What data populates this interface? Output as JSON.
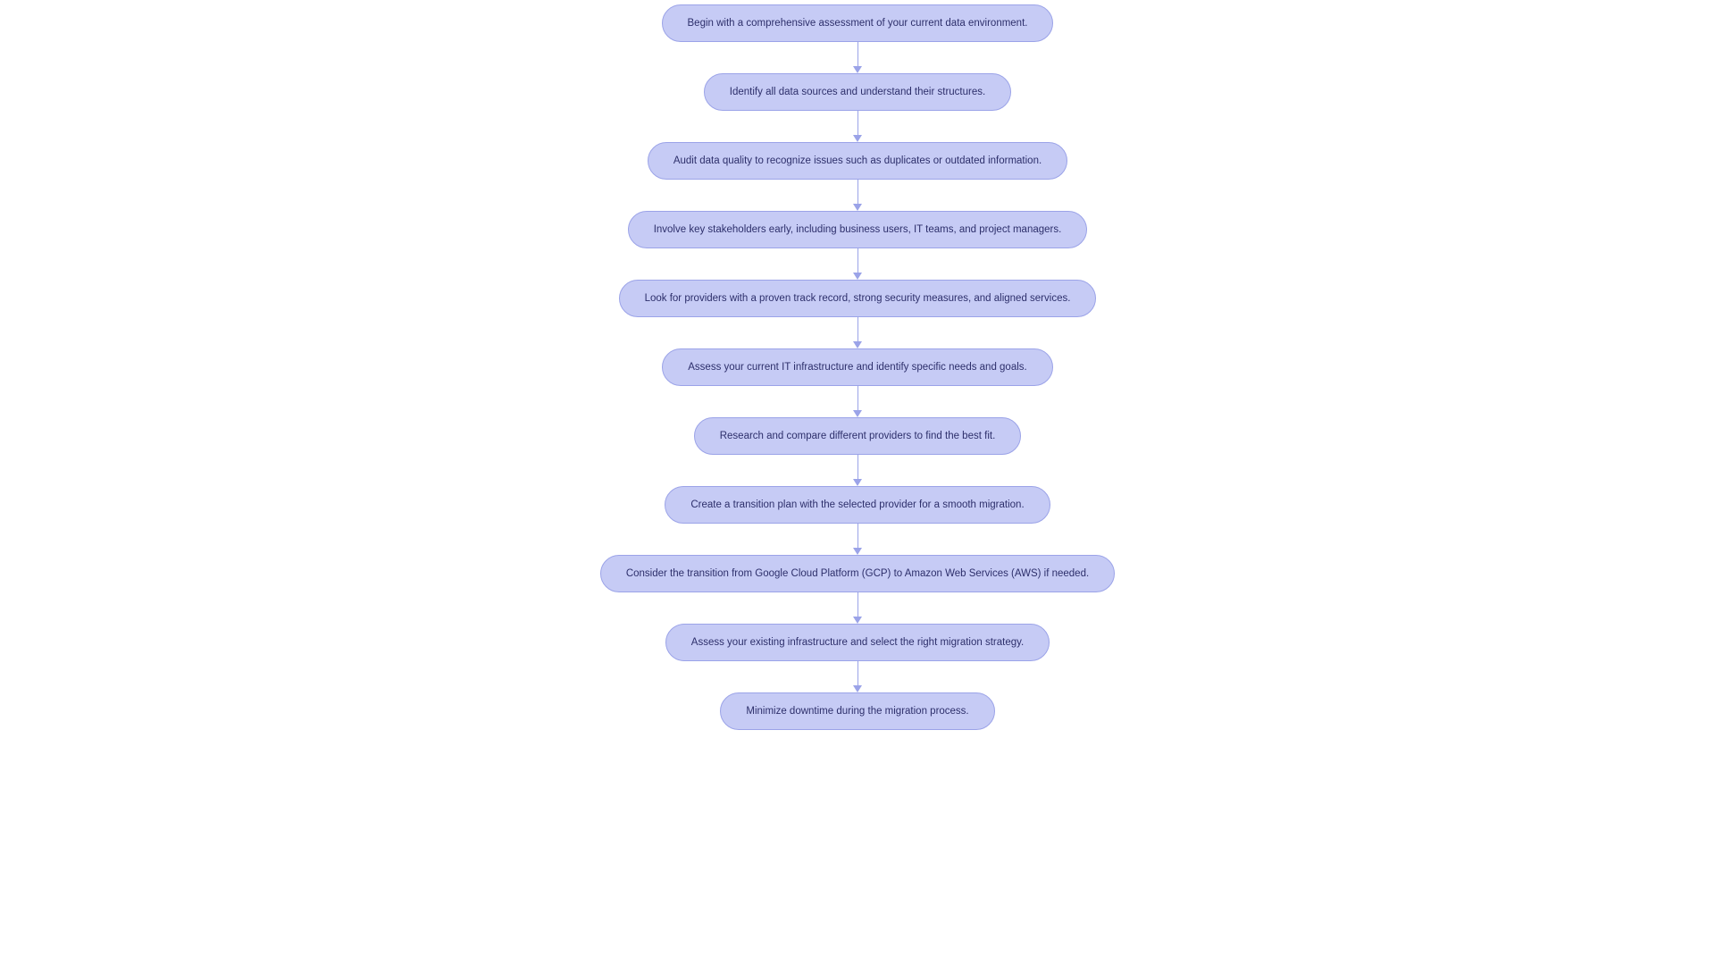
{
  "flowchart": {
    "nodes": [
      {
        "text": "Begin with a comprehensive assessment of your current data environment."
      },
      {
        "text": "Identify all data sources and understand their structures."
      },
      {
        "text": "Audit data quality to recognize issues such as duplicates or outdated information."
      },
      {
        "text": "Involve key stakeholders early, including business users, IT teams, and project managers."
      },
      {
        "text": "Look for providers with a proven track record, strong security measures, and aligned services."
      },
      {
        "text": "Assess your current IT infrastructure and identify specific needs and goals."
      },
      {
        "text": "Research and compare different providers to find the best fit."
      },
      {
        "text": "Create a transition plan with the selected provider for a smooth migration."
      },
      {
        "text": "Consider the transition from Google Cloud Platform (GCP) to Amazon Web Services (AWS) if needed."
      },
      {
        "text": "Assess your existing infrastructure and select the right migration strategy."
      },
      {
        "text": "Minimize downtime during the migration process."
      }
    ],
    "colors": {
      "node_fill": "#c6cbf5",
      "node_border": "#9ba3e8",
      "text": "#2d2f6b",
      "connector": "#9ba3e8"
    }
  }
}
